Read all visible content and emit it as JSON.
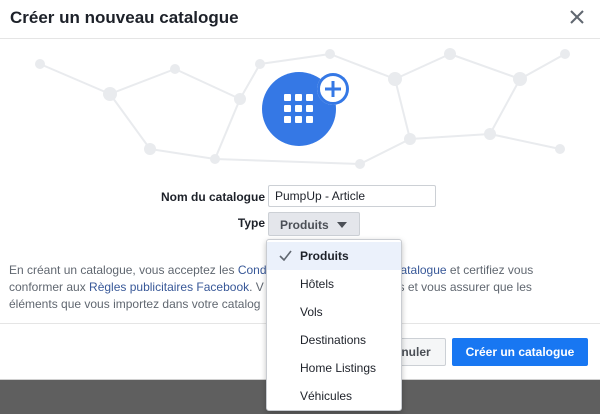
{
  "dialog": {
    "title": "Créer un nouveau catalogue"
  },
  "form": {
    "name_label": "Nom du catalogue",
    "name_value": "PumpUp - Article",
    "type_label": "Type",
    "type_value": "Produits"
  },
  "terms": {
    "part1": "En créant un catalogue, vous acceptez les ",
    "link1": "Cond",
    "part2": "e catalogue",
    "part3": " et certifiez vous conformer aux ",
    "link2": "Règles publicitaires Facebook",
    "part4": ". V",
    "part5": "es et vous assurer que les",
    "part6": "éléments que vous importez dans votre catalog"
  },
  "dropdown": {
    "options": [
      "Produits",
      "Hôtels",
      "Vols",
      "Destinations",
      "Home Listings",
      "Véhicules"
    ],
    "selected": "Produits"
  },
  "footer": {
    "cancel_label": "nuler",
    "create_label": "Créer un catalogue"
  },
  "colors": {
    "accent": "#1877f2",
    "hero": "#3578e5",
    "link": "#385898"
  }
}
